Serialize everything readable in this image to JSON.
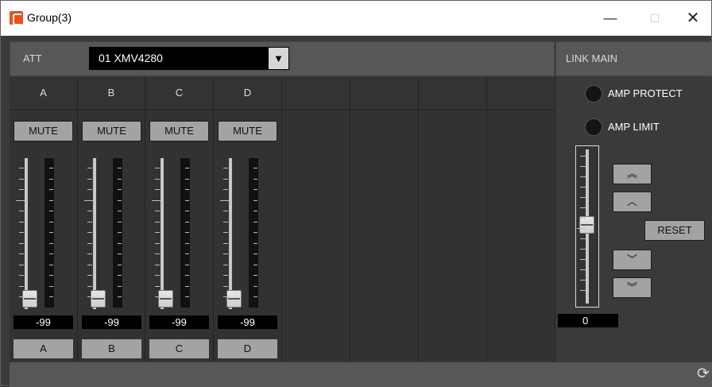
{
  "window": {
    "title": "Group(3)",
    "minimize": "—",
    "maximize": "□",
    "close": "✕"
  },
  "att": {
    "label": "ATT",
    "selected": "01 XMV4280",
    "arrow": "▼"
  },
  "link_main": {
    "label": "LINK MAIN"
  },
  "channels": [
    {
      "header": "A",
      "mute": "MUTE",
      "value": "-99",
      "name": "A"
    },
    {
      "header": "B",
      "mute": "MUTE",
      "value": "-99",
      "name": "B"
    },
    {
      "header": "C",
      "mute": "MUTE",
      "value": "-99",
      "name": "C"
    },
    {
      "header": "D",
      "mute": "MUTE",
      "value": "-99",
      "name": "D"
    }
  ],
  "main": {
    "amp_protect": "AMP PROTECT",
    "amp_limit": "AMP LIMIT",
    "reset": "RESET",
    "value": "0",
    "up_fast": "︽",
    "up": "︿",
    "down": "﹀",
    "down_fast": "︾"
  },
  "footer": {
    "refresh": "⟳"
  }
}
